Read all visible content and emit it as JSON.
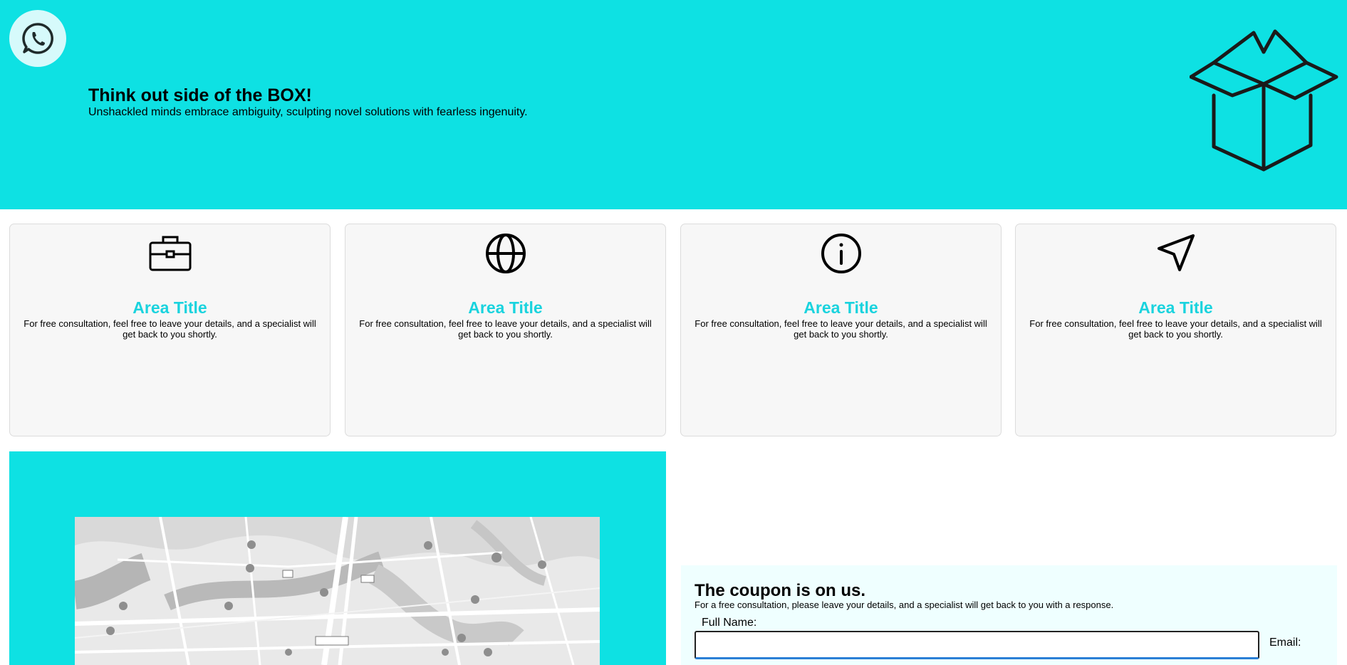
{
  "header": {
    "title": "Think out side of the BOX!",
    "subtitle": "Unshackled minds embrace ambiguity, sculpting novel solutions with fearless ingenuity.",
    "whatsapp_icon": "whatsapp-icon",
    "illustration_icon": "open-box-icon",
    "background_color": "#0ee1e3"
  },
  "cards": [
    {
      "icon": "briefcase-icon",
      "title": "Area Title",
      "description": "For free consultation, feel free to leave your details, and a specialist will get back to you shortly."
    },
    {
      "icon": "globe-icon",
      "title": "Area Title",
      "description": "For free consultation, feel free to leave your details, and a specialist will get back to you shortly."
    },
    {
      "icon": "info-icon",
      "title": "Area Title",
      "description": "For free consultation, feel free to leave your details, and a specialist will get back to you shortly."
    },
    {
      "icon": "navigation-arrow-icon",
      "title": "Area Title",
      "description": "For free consultation, feel free to leave your details, and a specialist will get back to you shortly."
    }
  ],
  "card_title_color": "#19d3de",
  "coupon": {
    "title": "The coupon is on us.",
    "subtitle": "For a free consultation, please leave your details, and a specialist will get back to you with a response.",
    "full_name_label": "Full Name:",
    "full_name_value": "",
    "email_label": "Email:"
  }
}
